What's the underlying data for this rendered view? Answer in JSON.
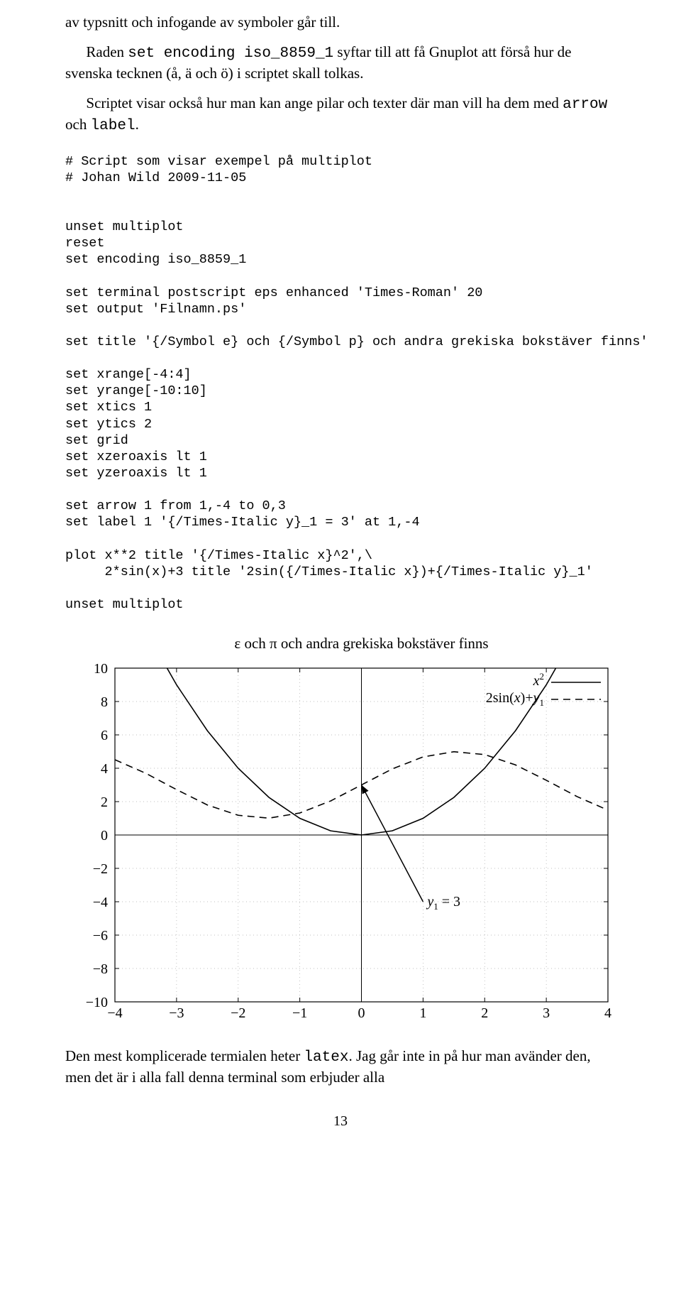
{
  "para1_a": "av typsnitt och infogande av symboler går till.",
  "para2_a": "Raden ",
  "para2_code": "set encoding iso_8859_1",
  "para2_b": " syftar till att få Gnuplot att förså hur de svenska tecknen (å, ä och ö) i scriptet skall tolkas.",
  "para3_a": "Scriptet visar också hur man kan ange pilar och texter där man vill ha dem med ",
  "para3_code1": "arrow",
  "para3_mid": " och ",
  "para3_code2": "label",
  "para3_end": ".",
  "code_block": "# Script som visar exempel på multiplot\n# Johan Wild 2009-11-05\n\n\nunset multiplot\nreset\nset encoding iso_8859_1\n\nset terminal postscript eps enhanced 'Times-Roman' 20\nset output 'Filnamn.ps'\n\nset title '{/Symbol e} och {/Symbol p} och andra grekiska bokstäver finns'\n\nset xrange[-4:4]\nset yrange[-10:10]\nset xtics 1\nset ytics 2\nset grid\nset xzeroaxis lt 1\nset yzeroaxis lt 1\n\nset arrow 1 from 1,-4 to 0,3\nset label 1 '{/Times-Italic y}_1 = 3' at 1,-4\n\nplot x**2 title '{/Times-Italic x}^2',\\\n     2*sin(x)+3 title '2sin({/Times-Italic x})+{/Times-Italic y}_1'\n\nunset multiplot",
  "para4_a": "Den mest komplicerade termialen heter ",
  "para4_code": "latex",
  "para4_b": ". Jag går inte in på hur man avänder den, men det är i alla fall denna terminal som erbjuder alla",
  "page_number": "13",
  "chart_data": {
    "type": "line",
    "title": "ε och π och andra grekiska bokstäver finns",
    "xlabel": "",
    "ylabel": "",
    "xlim": [
      -4,
      4
    ],
    "ylim": [
      -10,
      10
    ],
    "xticks": [
      -4,
      -3,
      -2,
      -1,
      0,
      1,
      2,
      3,
      4
    ],
    "yticks": [
      -10,
      -8,
      -6,
      -4,
      -2,
      0,
      2,
      4,
      6,
      8,
      10
    ],
    "grid": true,
    "label": {
      "text": "y₁ = 3",
      "x": 1,
      "y": -4
    },
    "arrow": {
      "from": [
        1,
        -4
      ],
      "to": [
        0,
        3
      ]
    },
    "legend": [
      "x²",
      "2sin(x)+y₁"
    ],
    "series": [
      {
        "name": "x²",
        "style": "solid",
        "x": [
          -4,
          -3.5,
          -3,
          -2.5,
          -2,
          -1.5,
          -1,
          -0.5,
          0,
          0.5,
          1,
          1.5,
          2,
          2.5,
          3,
          3.5,
          4
        ],
        "y": [
          16,
          12.25,
          9,
          6.25,
          4,
          2.25,
          1,
          0.25,
          0,
          0.25,
          1,
          2.25,
          4,
          6.25,
          9,
          12.25,
          16
        ]
      },
      {
        "name": "2sin(x)+y₁",
        "style": "dashed",
        "x": [
          -4,
          -3.5,
          -3,
          -2.5,
          -2,
          -1.5,
          -1,
          -0.5,
          0,
          0.5,
          1,
          1.5,
          2,
          2.5,
          3,
          3.5,
          4
        ],
        "y": [
          4.51,
          3.7,
          2.72,
          1.8,
          1.18,
          1.01,
          1.32,
          2.04,
          3.0,
          3.96,
          4.68,
          4.99,
          4.82,
          4.2,
          3.28,
          2.3,
          1.49
        ]
      }
    ]
  }
}
